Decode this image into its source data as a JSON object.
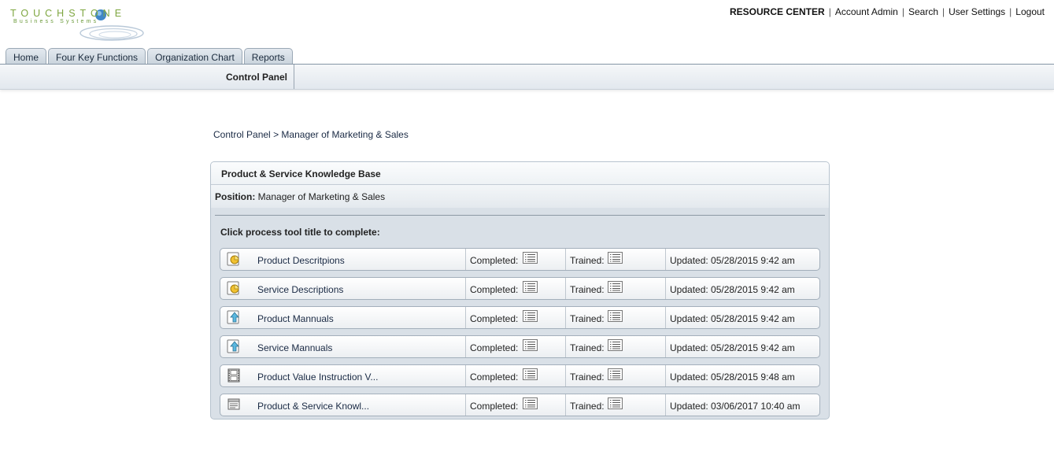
{
  "logo": {
    "title": "TOUCHSTONE",
    "subtitle": "Business Systems"
  },
  "top_links": [
    "RESOURCE CENTER",
    "Account Admin",
    "Search",
    "User Settings",
    "Logout"
  ],
  "tabs": [
    "Home",
    "Four Key Functions",
    "Organization Chart",
    "Reports"
  ],
  "subnav": {
    "item": "Control Panel"
  },
  "breadcrumb": {
    "root": "Control Panel",
    "separator": ">",
    "current": "Manager of Marketing & Sales"
  },
  "panel": {
    "title": "Product & Service Knowledge Base",
    "position_label": "Position:",
    "position_value": "Manager of Marketing & Sales",
    "instruction": "Click process tool title to complete:",
    "completed_label": "Completed:",
    "trained_label": "Trained:",
    "rows": [
      {
        "icon": "pie-chart-icon",
        "title": "Product Descritpions",
        "updated": "Updated: 05/28/2015 9:42 am"
      },
      {
        "icon": "pie-chart-icon",
        "title": "Service Descriptions",
        "updated": "Updated: 05/28/2015 9:42 am"
      },
      {
        "icon": "upload-arrow-icon",
        "title": "Product Mannuals",
        "updated": "Updated: 05/28/2015 9:42 am"
      },
      {
        "icon": "upload-arrow-icon",
        "title": "Service Mannuals",
        "updated": "Updated: 05/28/2015 9:42 am"
      },
      {
        "icon": "film-strip-icon",
        "title": "Product Value Instruction V...",
        "updated": "Updated: 05/28/2015 9:48 am"
      },
      {
        "icon": "form-document-icon",
        "title": "Product & Service Knowl...",
        "updated": "Updated: 03/06/2017 10:40 am"
      }
    ]
  },
  "colors": {
    "logo_green": "#7ea640",
    "logo_blue": "#3f86c8",
    "panel_bg": "#d9e0e7",
    "link": "#1a2a44"
  }
}
